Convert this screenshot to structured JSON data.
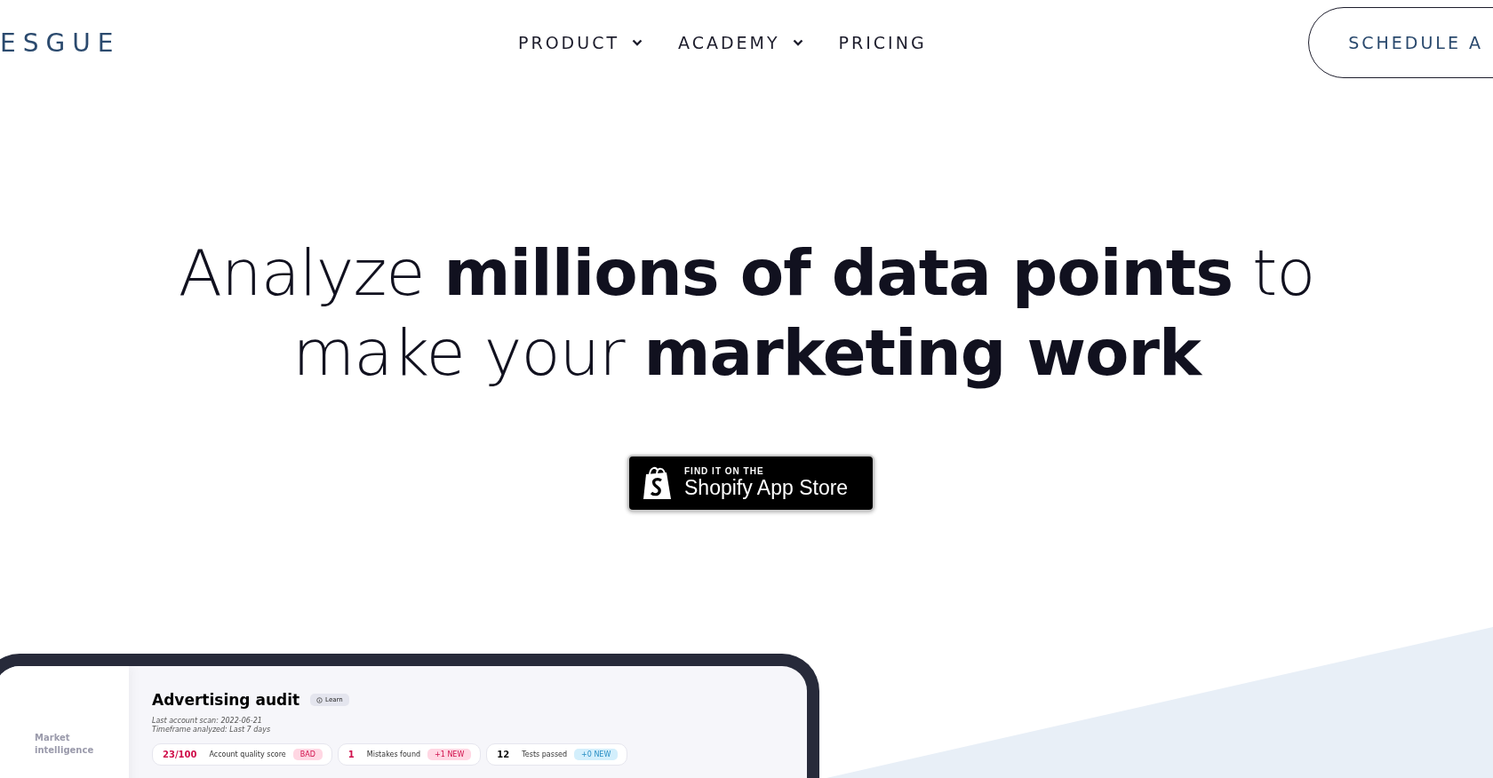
{
  "logo": "ESGUE",
  "nav": [
    {
      "label": "PRODUCT",
      "dropdown": true
    },
    {
      "label": "ACADEMY",
      "dropdown": true
    },
    {
      "label": "PRICING",
      "dropdown": false
    }
  ],
  "cta": "SCHEDULE A",
  "headline": "Analyze **millions of data points** to make your **marketing work**",
  "store_badge": {
    "eyebrow": "FIND IT ON THE",
    "label": "Shopify App Store"
  },
  "mockup": {
    "sidebar": [
      "Market intelligence"
    ],
    "title": "Advertising audit",
    "learn": "Learn",
    "meta": [
      "Last account scan: 2022-06-21",
      "Timeframe analyzed: Last 7 days"
    ],
    "stats": [
      {
        "value": "23/100",
        "label": "Account quality score",
        "tag": "BAD",
        "kind": "negative"
      },
      {
        "value": "1",
        "label": "Mistakes found",
        "tag": "+1 NEW",
        "kind": "negative"
      },
      {
        "value": "12",
        "label": "Tests passed",
        "tag": "+0 NEW",
        "kind": "positive"
      }
    ]
  }
}
